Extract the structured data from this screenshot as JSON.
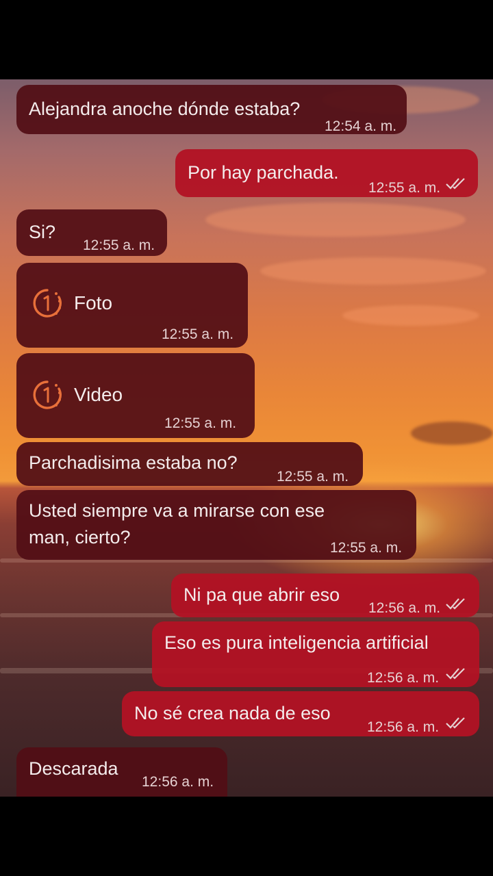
{
  "messages": [
    {
      "text": "Alejandra anoche dónde estaba?",
      "time": "12:54 a. m."
    },
    {
      "text": "Por hay parchada.",
      "time": "12:55 a. m."
    },
    {
      "text": "Si?",
      "time": "12:55 a. m."
    },
    {
      "text": "Foto",
      "time": "12:55 a. m.",
      "icon": "view-once-icon"
    },
    {
      "text": "Video",
      "time": "12:55 a. m.",
      "icon": "view-once-icon"
    },
    {
      "text": "Parchadisima estaba no?",
      "time": "12:55 a. m."
    },
    {
      "text_line1": "Usted siempre va a mirarse con ese",
      "text_line2": "man, cierto?",
      "time": "12:55 a. m."
    },
    {
      "text": "Ni pa que abrir eso",
      "time": "12:56 a. m."
    },
    {
      "text": "Eso es pura inteligencia artificial",
      "time": "12:56 a. m."
    },
    {
      "text": "No sé crea nada de eso",
      "time": "12:56 a. m."
    },
    {
      "text": "Descarada",
      "time": "12:56 a. m."
    }
  ],
  "colors": {
    "incoming_bubble": "#520e16",
    "outgoing_bubble": "#b21224",
    "view_once_icon": "#e8703a"
  }
}
